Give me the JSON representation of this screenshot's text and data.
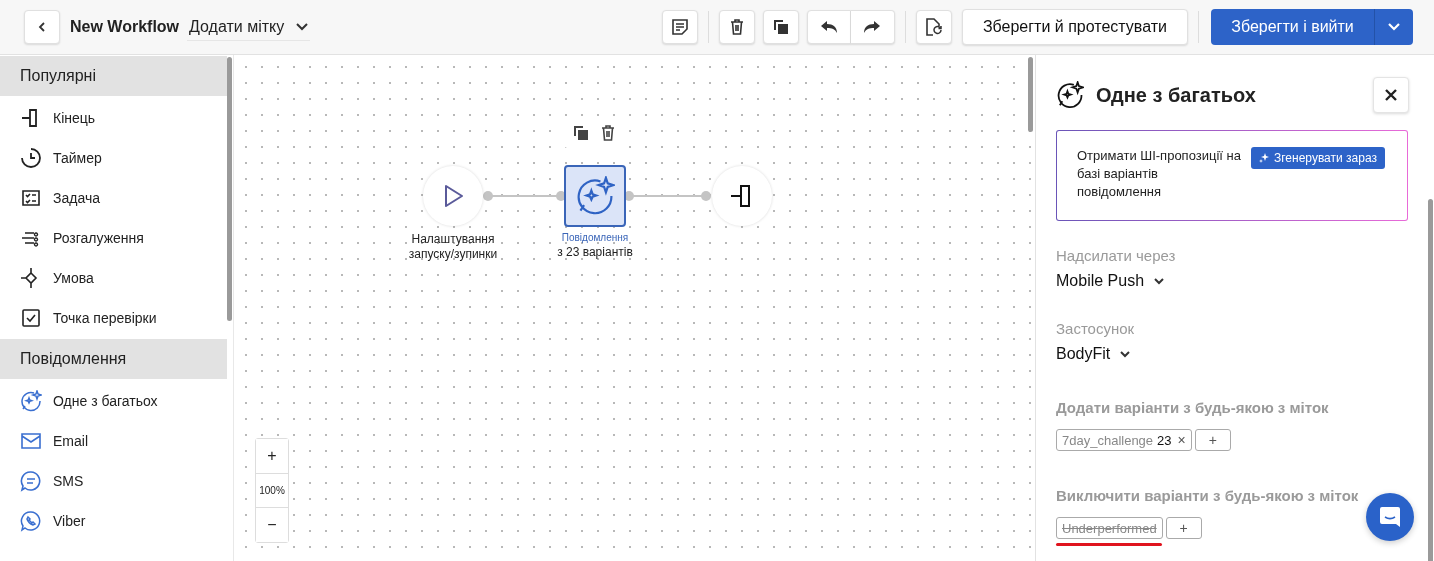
{
  "header": {
    "title": "New Workflow",
    "tag_dropdown": "Додати мітку",
    "save_test_button": "Зберегти й протестувати",
    "save_exit_button": "Зберегти і вийти"
  },
  "sidebar": {
    "sections": [
      {
        "title": "Популярні",
        "items": [
          {
            "label": "Кінець"
          },
          {
            "label": "Таймер"
          },
          {
            "label": "Задача"
          },
          {
            "label": "Розгалуження"
          },
          {
            "label": "Умова"
          },
          {
            "label": "Точка перевірки"
          }
        ]
      },
      {
        "title": "Повідомлення",
        "items": [
          {
            "label": "Одне з багатьох"
          },
          {
            "label": "Email"
          },
          {
            "label": "SMS"
          },
          {
            "label": "Viber"
          }
        ]
      }
    ]
  },
  "canvas": {
    "nodes": [
      {
        "kind": "start",
        "label": "Налаштування запуску/зупинки",
        "selected": false
      },
      {
        "kind": "message",
        "type": "Повідомлення",
        "label": "з 23 варіантів",
        "selected": true
      },
      {
        "kind": "end",
        "selected": false
      }
    ],
    "zoom": {
      "plus": "+",
      "level": "100%",
      "minus": "−"
    }
  },
  "panel": {
    "title": "Одне з багатьох",
    "ai_box": {
      "text": "Отримати ШІ-пропозиції на базі варіантів повідомлення",
      "button": "Згенерувати зараз"
    },
    "fields": [
      {
        "label": "Надсилати через",
        "value": "Mobile Push"
      },
      {
        "label": "Застосунок",
        "value": "BodyFit"
      }
    ],
    "tag_groups": [
      {
        "label": "Додати варіанти з будь-якою з міток",
        "add": "+",
        "tags": [
          {
            "text": "7day_challenge",
            "count": "23",
            "remove": "×",
            "struck": false
          }
        ]
      },
      {
        "label": "Виключити варіанти з будь-якою з міток",
        "add": "+",
        "tags": [
          {
            "text": "Underperformed",
            "struck": true
          }
        ]
      }
    ]
  }
}
